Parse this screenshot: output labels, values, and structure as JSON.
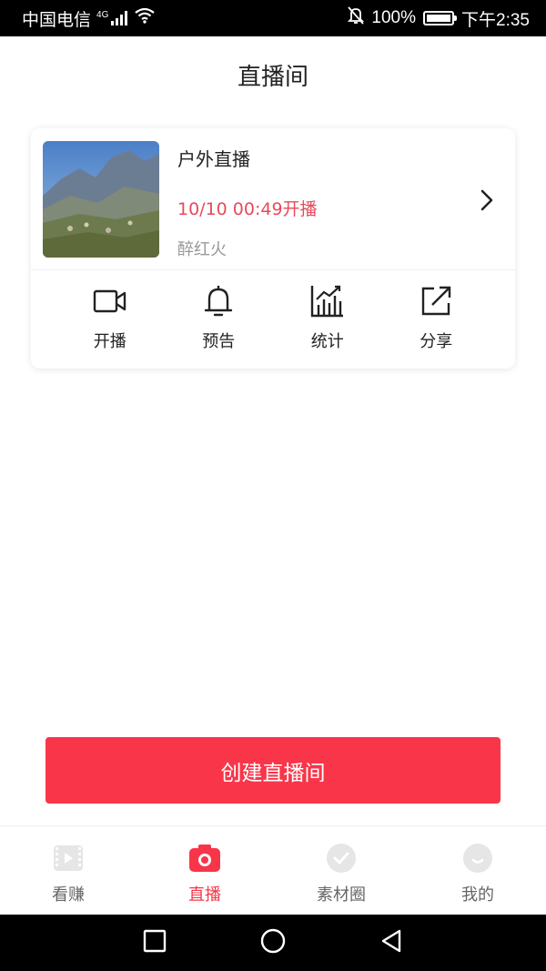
{
  "status_bar": {
    "carrier": "中国电信",
    "network": "4G",
    "battery_percent": "100%",
    "time": "下午2:35",
    "icons": [
      "signal-icon",
      "wifi-icon",
      "mute-bell-icon",
      "battery-icon"
    ]
  },
  "header": {
    "title": "直播间"
  },
  "room": {
    "name": "户外直播",
    "schedule": "10/10 00:49开播",
    "host": "醉红火",
    "cover_icon": "mountain-thumbnail"
  },
  "actions": [
    {
      "label": "开播",
      "icon": "video-camera-icon"
    },
    {
      "label": "预告",
      "icon": "bell-icon"
    },
    {
      "label": "统计",
      "icon": "bar-chart-icon"
    },
    {
      "label": "分享",
      "icon": "share-icon"
    }
  ],
  "create_button": {
    "label": "创建直播间"
  },
  "tabs": [
    {
      "label": "看赚",
      "icon": "play-film-icon",
      "active": false
    },
    {
      "label": "直播",
      "icon": "camera-icon",
      "active": true
    },
    {
      "label": "素材圈",
      "icon": "check-bubble-icon",
      "active": false
    },
    {
      "label": "我的",
      "icon": "smile-icon",
      "active": false
    }
  ],
  "colors": {
    "accent": "#f93549",
    "schedule_text": "#e84a5b",
    "muted_text": "#999999",
    "inactive_icon": "#e0e0e0"
  }
}
